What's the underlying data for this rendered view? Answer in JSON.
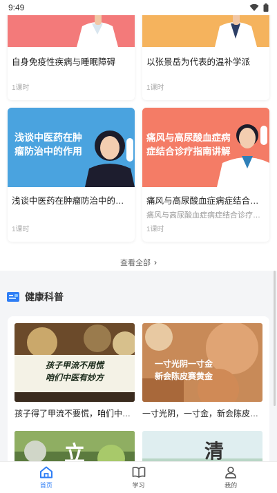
{
  "status_bar": {
    "time": "9:49"
  },
  "courses": [
    {
      "title": "自身免疫性疾病与睡眠障碍",
      "subtitle": "",
      "lessons": "1课时",
      "thumb_text": "",
      "color": "#f37a7a"
    },
    {
      "title": "以张景岳为代表的温补学派",
      "subtitle": "",
      "lessons": "1课时",
      "thumb_text": "",
      "color": "#f5b35d"
    },
    {
      "title": "浅谈中医药在肿瘤防治中的作用",
      "subtitle": "",
      "lessons": "1课时",
      "thumb_text": "浅谈中医药在肿瘤防治中的作用",
      "color": "#4aa3df"
    },
    {
      "title": "痛风与高尿酸血症病症结合诊疗指南讲解",
      "subtitle": "痛风与高尿酸血症病症结合诊疗指南讲解",
      "lessons": "1课时",
      "thumb_text": "痛风与高尿酸血症病症结合诊疗指南讲解",
      "color": "#f47c66"
    }
  ],
  "view_all": {
    "label": "查看全部"
  },
  "health_science": {
    "title": "健康科普",
    "items": [
      {
        "title": "孩子得了甲流不要慌，咱们中医有妙方",
        "thumb_text": "孩子甲流不用慌\n咱们中医有妙方"
      },
      {
        "title": "一寸光阴，一寸金，新会陈皮赛黄金",
        "thumb_text": "一寸光阴一寸金\n新会陈皮赛黄金"
      },
      {
        "title": "",
        "thumb_text": "立"
      },
      {
        "title": "",
        "thumb_text": "清"
      }
    ]
  },
  "tab_bar": {
    "tabs": [
      {
        "label": "首页",
        "active": true
      },
      {
        "label": "学习",
        "active": false
      },
      {
        "label": "我的",
        "active": false
      }
    ]
  },
  "colors": {
    "accent": "#2f7ef5"
  }
}
